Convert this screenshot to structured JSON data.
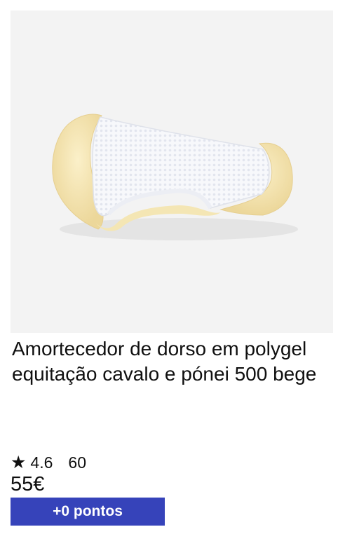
{
  "product": {
    "image_alt": "Amortecedor de dorso em polygel equitação cavalo e pónei 500 bege",
    "title": "Amortecedor de dorso em polygel equitação cavalo e pónei 500 bege",
    "rating_icon": "star-icon",
    "rating": "4.6",
    "review_count": "60",
    "price": "55€",
    "points": "+0 pontos"
  },
  "colors": {
    "image_background": "#f3f3f3",
    "points_badge": "#3643ba",
    "text": "#101010"
  }
}
